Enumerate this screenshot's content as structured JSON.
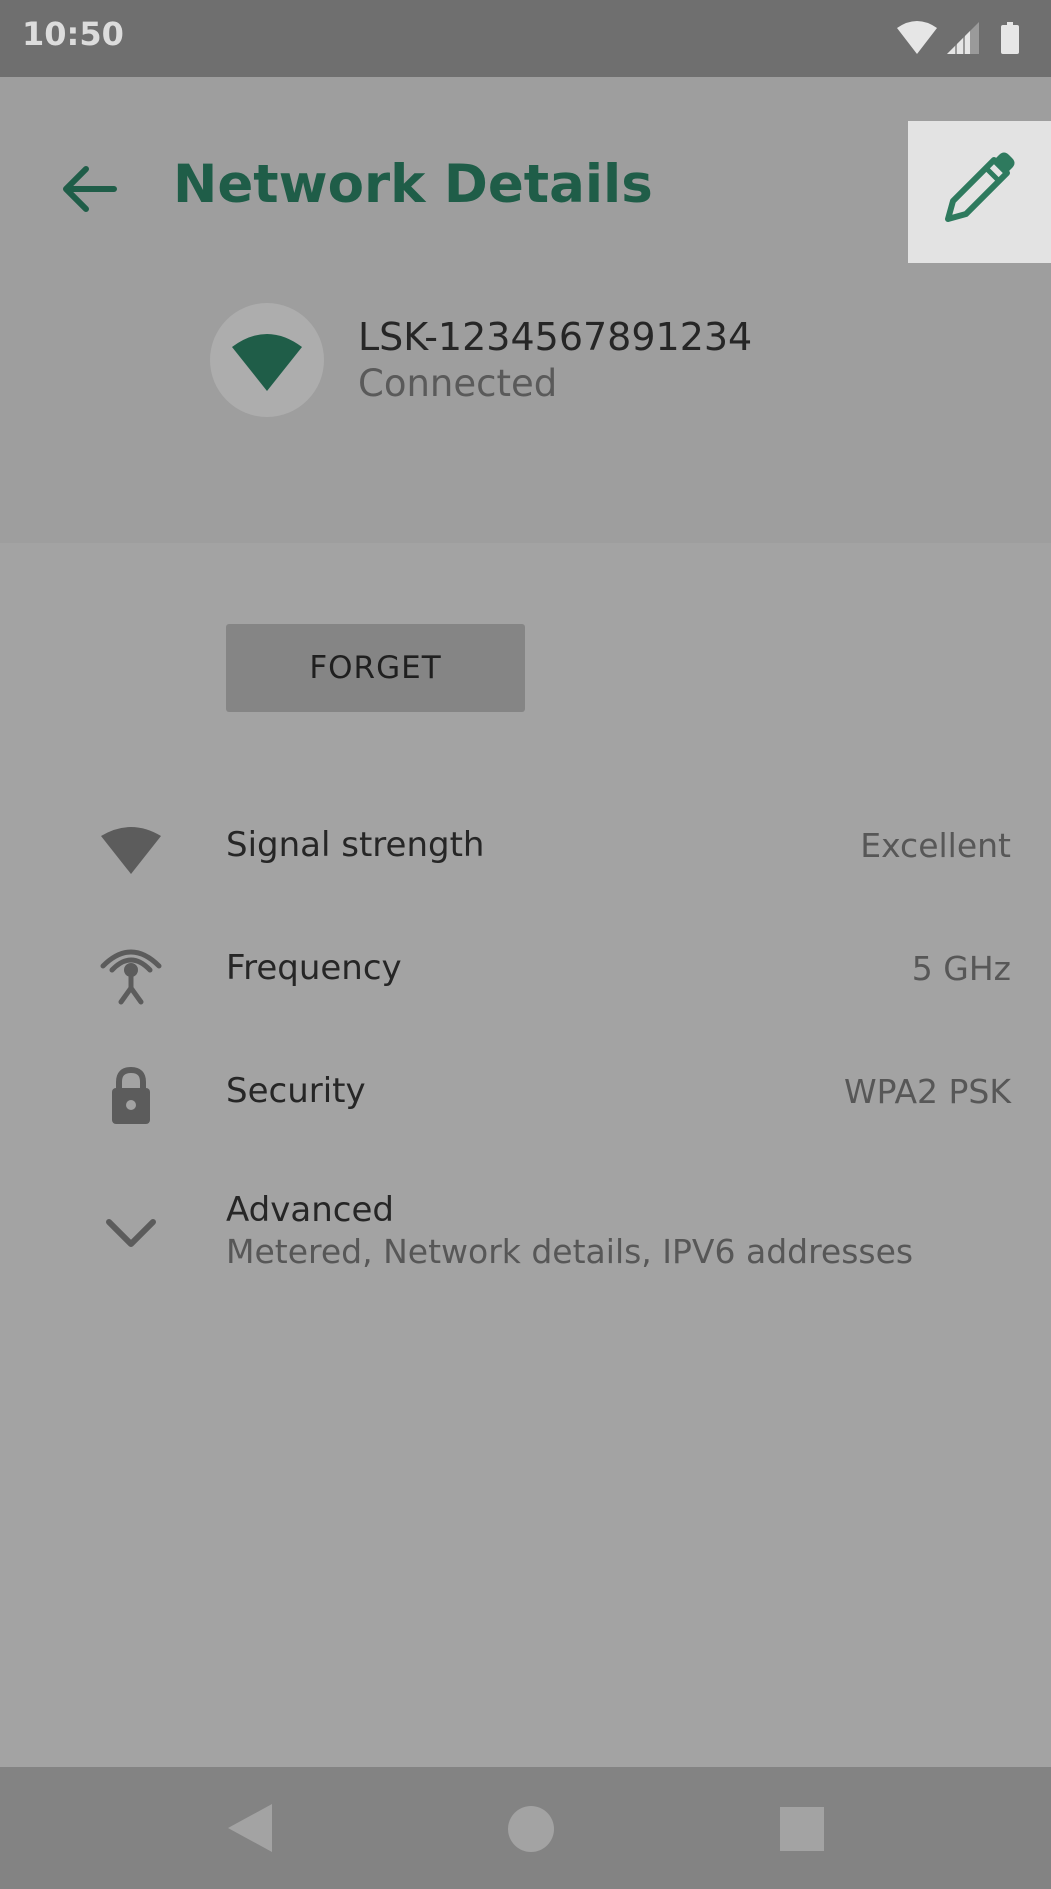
{
  "status_bar": {
    "time": "10:50",
    "icons": [
      "wifi-icon",
      "cell-signal-icon",
      "battery-icon"
    ]
  },
  "header": {
    "title": "Network Details",
    "back_icon": "arrow-back-icon",
    "edit_icon": "pencil-icon"
  },
  "network": {
    "name": "LSK-1234567891234",
    "status": "Connected",
    "icon": "wifi-icon"
  },
  "actions": {
    "forget_label": "FORGET"
  },
  "details": [
    {
      "label": "Signal strength",
      "value": "Excellent",
      "icon": "wifi-signal-icon"
    },
    {
      "label": "Frequency",
      "value": "5 GHz",
      "icon": "antenna-icon"
    },
    {
      "label": "Security",
      "value": "WPA2 PSK",
      "icon": "lock-icon"
    }
  ],
  "advanced": {
    "label": "Advanced",
    "subtitle": "Metered, Network details, IPV6 addresses",
    "icon": "chevron-down-icon"
  },
  "nav_bar": {
    "icons": [
      "back-triangle-icon",
      "home-circle-icon",
      "recents-square-icon"
    ]
  },
  "colors": {
    "accent": "#1f5d48",
    "status_bar": "#6f6f6f",
    "header": "#9e9e9e",
    "body": "#a3a3a3",
    "nav_bar": "#838383",
    "button": "#858585"
  }
}
